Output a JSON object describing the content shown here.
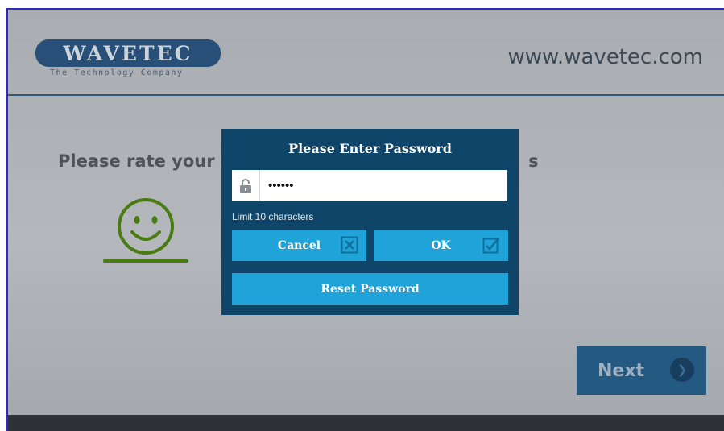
{
  "header": {
    "logo_text": "WAVETEC",
    "logo_tagline": "The Technology Company",
    "site_url": "www.wavetec.com"
  },
  "survey": {
    "question": "Please rate your e",
    "question_tail": "s",
    "next_label": "Next"
  },
  "dialog": {
    "title": "Please Enter Password",
    "password_value": "••••••",
    "limit_text": "Limit 10 characters",
    "cancel_label": "Cancel",
    "ok_label": "OK",
    "reset_label": "Reset Password"
  },
  "icons": {
    "lock": "lock-icon",
    "cancel": "close-box-icon",
    "ok": "checkbox-icon",
    "next": "chevron-right-icon",
    "smiley": "smiley-face-icon"
  },
  "colors": {
    "dialog_bg": "#0f4569",
    "button_bg": "#1fa3d8",
    "next_bg": "#245a82",
    "smiley": "#4a7a12"
  }
}
